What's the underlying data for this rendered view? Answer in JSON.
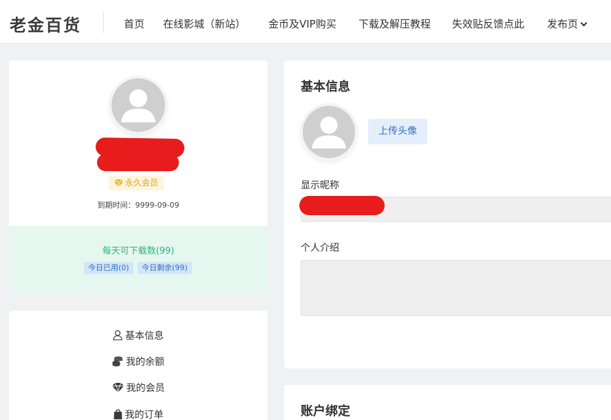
{
  "header": {
    "logo": "老金百货",
    "nav": [
      {
        "label": "首页"
      },
      {
        "label": "在线影城（新站）"
      },
      {
        "label": "金币及VIP购买"
      },
      {
        "label": "下载及解压教程"
      },
      {
        "label": "失效贴反馈点此"
      },
      {
        "label": "发布页"
      }
    ]
  },
  "profile": {
    "vip_badge": "永久会员",
    "expire_text": "到期时间：9999-09-09",
    "quota_title": "每天可下载数(99)",
    "used_today": "今日已用(0)",
    "remaining_today": "今日剩余(99)"
  },
  "menu": [
    {
      "label": "基本信息",
      "icon": "user-icon"
    },
    {
      "label": "我的余额",
      "icon": "coins-icon"
    },
    {
      "label": "我的会员",
      "icon": "diamond-icon"
    },
    {
      "label": "我的订单",
      "icon": "shopping-bag-icon"
    }
  ],
  "basic_info": {
    "title": "基本信息",
    "upload_button": "上传头像",
    "nickname_label": "显示昵称",
    "bio_label": "个人介绍"
  },
  "account_binding": {
    "title": "账户绑定"
  },
  "colors": {
    "accent_blue": "#2f6fc9",
    "quota_green": "#2fb37b",
    "vip_gold": "#e0a521",
    "redaction": "#e81c1c"
  }
}
